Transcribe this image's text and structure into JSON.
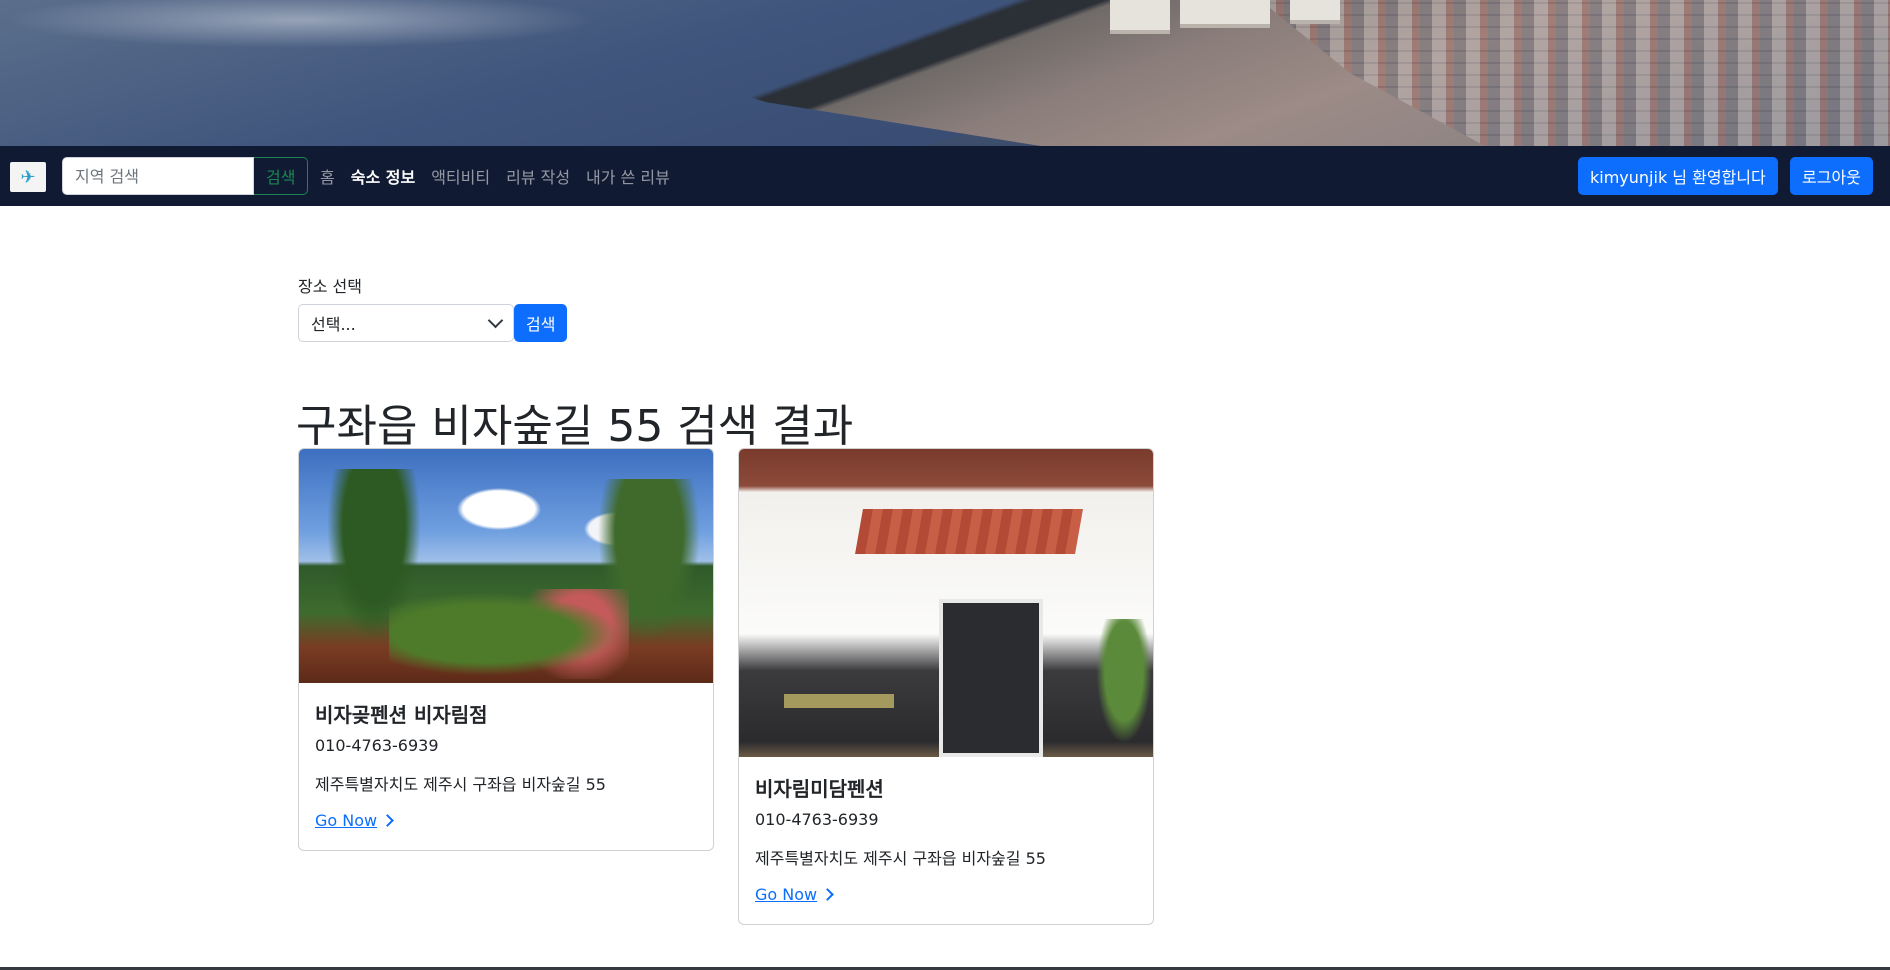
{
  "navbar": {
    "search": {
      "placeholder": "지역 검색",
      "button_label": "검색"
    },
    "links": [
      {
        "label": "홈",
        "active": false
      },
      {
        "label": "숙소 정보",
        "active": true
      },
      {
        "label": "액티비티",
        "active": false
      },
      {
        "label": "리뷰 작성",
        "active": false
      },
      {
        "label": "내가 쓴 리뷰",
        "active": false
      }
    ],
    "welcome_label": "kimyunjik 님 환영합니다",
    "logout_label": "로그아웃"
  },
  "filter": {
    "label": "장소 선택",
    "select_value": "선택...",
    "button_label": "검색"
  },
  "results": {
    "title": "구좌읍 비자숲길 55 검색 결과",
    "cards": [
      {
        "title": "비자곶펜션 비자림점",
        "phone": "010-4763-6939",
        "address": "제주특별자치도 제주시 구좌읍 비자숲길 55",
        "link_label": "Go Now"
      },
      {
        "title": "비자림미담펜션",
        "phone": "010-4763-6939",
        "address": "제주특별자치도 제주시 구좌읍 비자숲길 55",
        "link_label": "Go Now"
      }
    ]
  },
  "colors": {
    "navbar": "#111a33",
    "primary": "#0d6efd",
    "success": "#198754"
  }
}
